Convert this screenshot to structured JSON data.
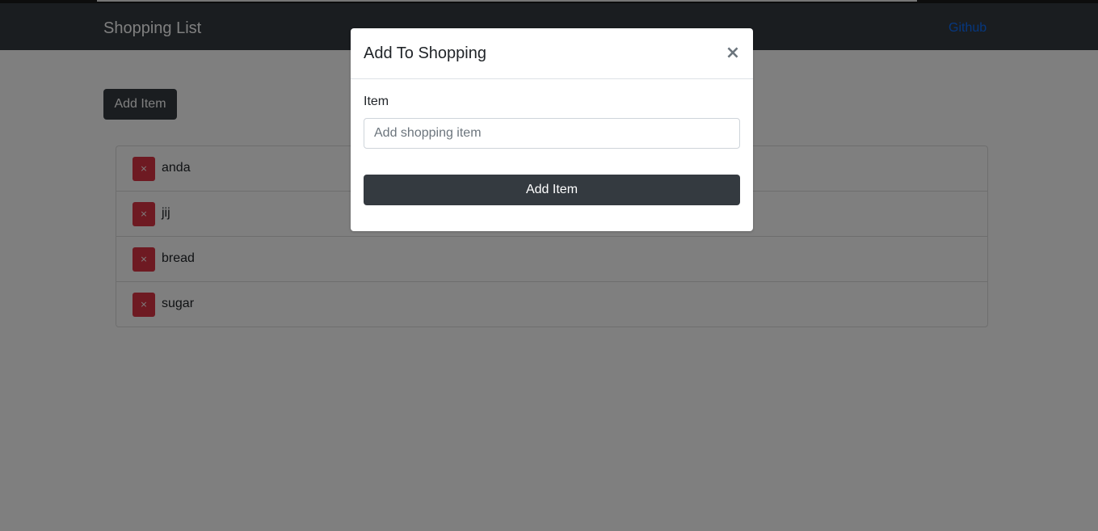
{
  "navbar": {
    "brand": "Shopping List",
    "link": "Github"
  },
  "main": {
    "add_button_label": "Add Item",
    "items": [
      {
        "name": "anda",
        "delete_label": "×"
      },
      {
        "name": "jij",
        "delete_label": "×"
      },
      {
        "name": "bread",
        "delete_label": "×"
      },
      {
        "name": "sugar",
        "delete_label": "×"
      }
    ]
  },
  "modal": {
    "title": "Add To Shopping",
    "close_label": "×",
    "field_label": "Item",
    "input_placeholder": "Add shopping item",
    "input_value": "",
    "submit_label": "Add Item"
  },
  "colors": {
    "navbar": "#343a40",
    "link": "#0d6efd",
    "danger": "#dc3545",
    "dark_button": "#343a40",
    "backdrop": "rgba(0,0,0,0.5)"
  },
  "icons": {
    "delete": "close-icon",
    "modal_close": "close-icon"
  }
}
